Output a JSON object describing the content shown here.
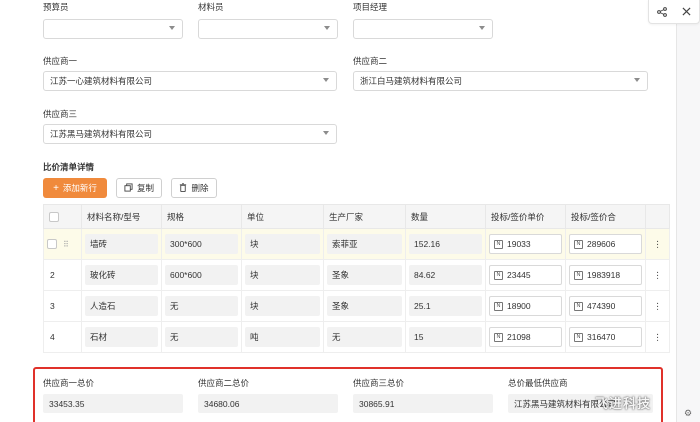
{
  "top_fields": {
    "estimator_label": "预算员",
    "estimator_value": "",
    "material_clerk_label": "材料员",
    "material_clerk_value": "",
    "pm_label": "项目经理",
    "pm_value": ""
  },
  "suppliers": {
    "s1_label": "供应商一",
    "s1_value": "江苏一心建筑材料有限公司",
    "s2_label": "供应商二",
    "s2_value": "浙江白马建筑材料有限公司",
    "s3_label": "供应商三",
    "s3_value": "江苏黑马建筑材料有限公司"
  },
  "section_title": "比价清单详情",
  "toolbar": {
    "add_label": "添加新行",
    "copy_label": "复制",
    "delete_label": "删除"
  },
  "table": {
    "headers": [
      "材料名称/型号",
      "规格",
      "单位",
      "生产厂家",
      "数量",
      "投标/签价单价",
      "投标/签价合"
    ],
    "rows": [
      {
        "index": "",
        "name": "墙砖",
        "spec": "300*600",
        "unit": "块",
        "maker": "索菲亚",
        "qty": "152.16",
        "price": "19033",
        "total": "289606"
      },
      {
        "index": "2",
        "name": "玻化砖",
        "spec": "600*600",
        "unit": "块",
        "maker": "圣象",
        "qty": "84.62",
        "price": "23445",
        "total": "1983918"
      },
      {
        "index": "3",
        "name": "人造石",
        "spec": "无",
        "unit": "块",
        "maker": "圣象",
        "qty": "25.1",
        "price": "18900",
        "total": "474390"
      },
      {
        "index": "4",
        "name": "石材",
        "spec": "无",
        "unit": "吨",
        "maker": "无",
        "qty": "15",
        "price": "21098",
        "total": "316470"
      }
    ]
  },
  "totals": {
    "s1_label": "供应商一总价",
    "s1_value": "33453.35",
    "s2_label": "供应商二总价",
    "s2_value": "34680.06",
    "s3_label": "供应商三总价",
    "s3_value": "30865.91",
    "min_label": "总价最低供应商",
    "min_value": "江苏黑马建筑材料有限公司"
  },
  "watermark": "飞进科技",
  "colors": {
    "primary": "#f08a3c",
    "highlight_border": "#e0312a"
  }
}
